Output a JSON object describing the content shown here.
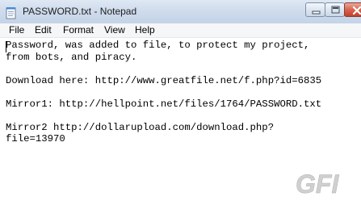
{
  "window": {
    "title": "PASSWORD.txt - Notepad"
  },
  "menu": {
    "file": "File",
    "edit": "Edit",
    "format": "Format",
    "view": "View",
    "help": "Help"
  },
  "document": {
    "text": "Password, was added to file, to protect my project,\nfrom bots, and piracy.\n\nDownload here: http://www.greatfile.net/f.php?id=6835\n\nMirror1: http://hellpoint.net/files/1764/PASSWORD.txt\n\nMirror2 http://dollarupload.com/download.php?\nfile=13970"
  },
  "watermark": {
    "text": "GFI"
  },
  "colors": {
    "titlebar": "#cfdcec",
    "close_button": "#d9634f",
    "menubar": "#f5f6f8",
    "watermark": "#c8c8c8"
  }
}
